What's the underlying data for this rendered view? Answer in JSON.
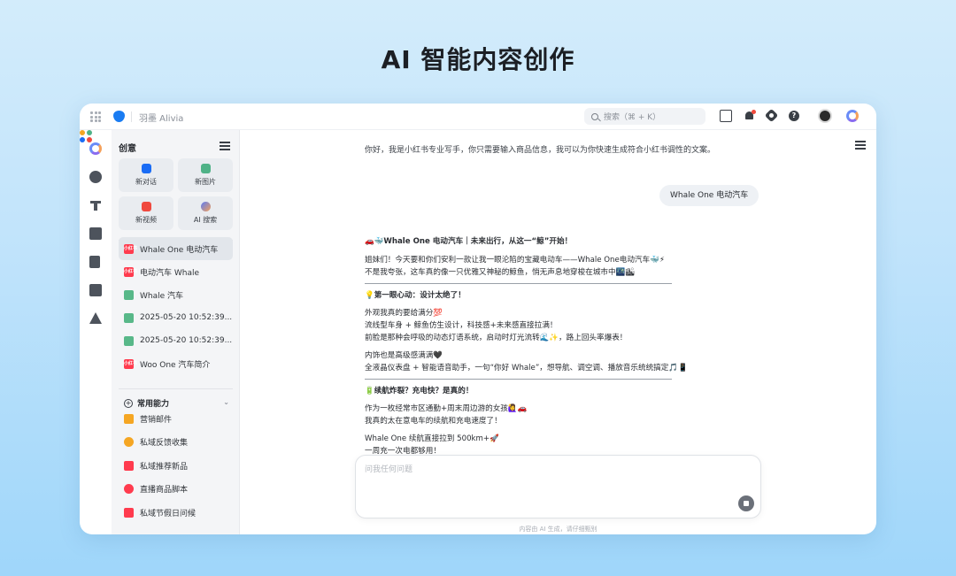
{
  "hero": {
    "title": "AI 智能内容创作"
  },
  "topbar": {
    "app_name": "羽墨 Alivia",
    "search_placeholder": "搜索（⌘ + K）"
  },
  "sidebar": {
    "header": "创意",
    "quick_actions": [
      {
        "label": "新对话",
        "icon": "chat-icon",
        "color": "#1a6cf5"
      },
      {
        "label": "新图片",
        "icon": "image-icon",
        "color": "#4fb287"
      },
      {
        "label": "新视频",
        "icon": "video-icon",
        "color": "#f0493f"
      },
      {
        "label": "AI 搜索",
        "icon": "ai-search-icon",
        "color": "#5b7cf5"
      }
    ],
    "history": [
      {
        "label": "Whale One 电动汽车",
        "icon": "xiaohongshu-icon",
        "badge": "小红书",
        "active": true
      },
      {
        "label": "电动汽车 Whale",
        "icon": "xiaohongshu-icon",
        "badge": "小红书"
      },
      {
        "label": "Whale 汽车",
        "icon": "document-icon"
      },
      {
        "label": "2025-05-20 10:52:39...",
        "icon": "document-icon"
      },
      {
        "label": "2025-05-20 10:52:39...",
        "icon": "document-icon"
      },
      {
        "label": "Woo One 汽车简介",
        "icon": "xiaohongshu-icon",
        "badge": "小红书"
      }
    ],
    "capabilities_header": "常用能力",
    "capabilities": [
      {
        "label": "营销邮件",
        "icon": "mail-icon",
        "color": "#f5a623"
      },
      {
        "label": "私域反馈收集",
        "icon": "feedback-icon",
        "color": "#f5a623"
      },
      {
        "label": "私域推荐新品",
        "icon": "recommend-icon",
        "color": "#ff3b4e"
      },
      {
        "label": "直播商品脚本",
        "icon": "live-icon",
        "color": "#ff3b4e"
      },
      {
        "label": "私域节假日问候",
        "icon": "holiday-icon",
        "color": "#ff3b4e"
      }
    ]
  },
  "chat": {
    "intro": "你好，我是小红书专业写手，你只需要输入商品信息，我可以为你快速生成符合小红书调性的文案。",
    "user_message": "Whale One 电动汽车",
    "answer": {
      "title": "🚗🐳Whale One 电动汽车｜未来出行，从这一“鲸”开始！",
      "intro_lines": [
        "姐妹们！今天要和你们安利一款让我一眼沦陷的宝藏电动车——Whale One电动汽车🐳⚡",
        "不是我夸张，这车真的像一只优雅又神秘的鲸鱼，悄无声息地穿梭在城市中🌃🏙"
      ],
      "section1_title": "💡第一眼心动：设计太绝了！",
      "section1_lines_a": [
        "外观我真的要给满分💯",
        "流线型车身 + 鲸鱼仿生设计，科技感+未来感直接拉满！",
        "前脸是那种会呼吸的动态灯语系统，启动时灯光流转🌊✨，路上回头率爆表！"
      ],
      "section1_lines_b": [
        "内饰也是高级感满满🖤",
        "全液晶仪表盘 + 智能语音助手，一句“你好 Whale”，想导航、调空调、播放音乐统统搞定🎵📱"
      ],
      "section2_title": "🔋续航炸裂？充电快？是真的！",
      "section2_lines_a": [
        "作为一枚经常市区通勤+周末周边游的女孩🙋‍♀️🚗",
        "我真的太在意电车的续航和充电速度了！"
      ],
      "section2_lines_b": [
        "Whale One 续航直接拉到 500km+🚀",
        "一周充一次电都够用！"
      ]
    },
    "input_placeholder": "问我任何问题",
    "disclaimer": "内容由 AI 生成，请仔细甄别"
  },
  "colors": {
    "accent": "#1a7cf2",
    "background_top": "#d3ecfb",
    "background_bottom": "#9fd6fa"
  }
}
